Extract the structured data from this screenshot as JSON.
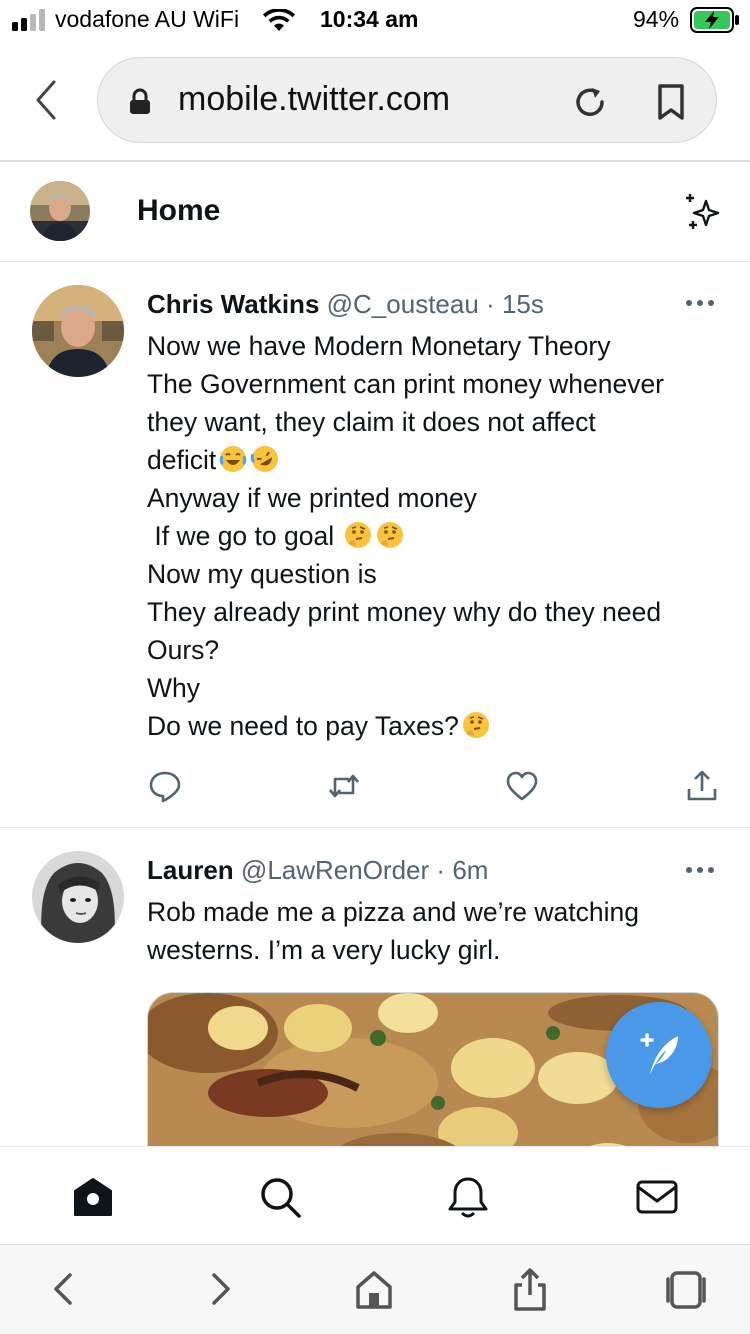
{
  "status_bar": {
    "carrier": "vodafone AU WiFi",
    "time": "10:34 am",
    "battery": "94%"
  },
  "browser": {
    "url": "mobile.twitter.com"
  },
  "header": {
    "title": "Home"
  },
  "tweets": [
    {
      "name": "Chris Watkins",
      "handle": "@C_ousteau",
      "separator": "·",
      "time": "15s",
      "lines": [
        "Now we have Modern Monetary Theory",
        "The Government can print money whenever",
        "they want, they claim it does not affect",
        "deficit",
        "Anyway if we printed money",
        " If we go to goal",
        "Now my question is",
        "They already print money why do they need",
        "Ours?",
        "Why",
        "Do we need to pay Taxes?"
      ],
      "emojis": {
        "line4": [
          "face-with-tears-of-joy",
          "rolling-on-floor-laughing"
        ],
        "line6": [
          "thinking-face",
          "thinking-face"
        ],
        "line11": [
          "thinking-face"
        ]
      }
    },
    {
      "name": "Lauren",
      "handle": "@LawRenOrder",
      "separator": "·",
      "time": "6m",
      "lines": [
        "Rob made me a pizza and we’re watching",
        "westerns. I’m a very lucky girl."
      ]
    }
  ],
  "colors": {
    "accent": "#1d9bf0",
    "fab": "#4a99e9",
    "secondary_text": "#536471",
    "primary_text": "#0f1419"
  },
  "icons": {
    "status": [
      "signal-icon",
      "wifi-icon",
      "battery-charging-icon"
    ],
    "browser": [
      "back-chevron-icon",
      "lock-icon",
      "reload-icon",
      "bookmark-icon"
    ],
    "header": [
      "sparkle-icon"
    ],
    "tweet_actions": [
      "reply-icon",
      "retweet-icon",
      "like-icon",
      "share-icon"
    ],
    "fab": "compose-tweet-icon",
    "tabbar": [
      "home-icon",
      "search-icon",
      "notifications-icon",
      "messages-icon"
    ],
    "safari_toolbar": [
      "back-icon",
      "forward-icon",
      "home-icon",
      "share-icon",
      "tabs-icon"
    ]
  }
}
